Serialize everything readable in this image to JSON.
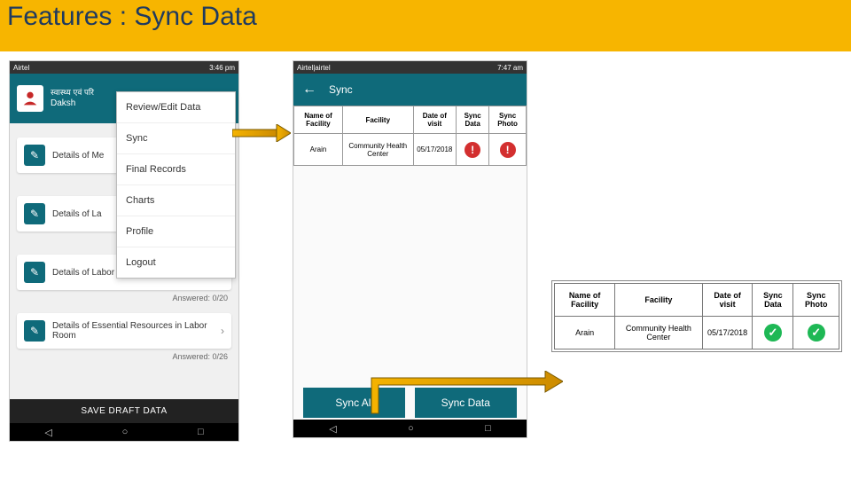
{
  "title": "Features : Sync Data",
  "phone1": {
    "status_left": "Airtel",
    "status_right": "3:46 pm",
    "header_hindi": "स्वास्थ्य एवं परि",
    "header_sub": "Daksh",
    "menu": {
      "items": [
        "Review/Edit Data",
        "Sync",
        "Final Records",
        "Charts",
        "Profile",
        "Logout"
      ]
    },
    "cards": [
      {
        "label": "Details of Me"
      },
      {
        "label": "Details of La"
      },
      {
        "label": "Details of Labor Room Infrastructure",
        "answered": "Answered: 0/20"
      },
      {
        "label": "Details of Essential Resources in Labor Room",
        "answered": "Answered: 0/26"
      }
    ],
    "save_draft": "SAVE DRAFT DATA"
  },
  "phone2": {
    "status_left": "Airtel|airtel",
    "status_right": "7:47 am",
    "sync_title": "Sync",
    "table": {
      "headers": [
        "Name of Facility",
        "Facility",
        "Date of visit",
        "Sync Data",
        "Sync Photo"
      ],
      "row": {
        "name": "Arain",
        "facility": "Community Health Center",
        "date": "05/17/2018"
      }
    },
    "btn_all": "Sync All",
    "btn_data": "Sync Data"
  },
  "result": {
    "headers": [
      "Name of Facility",
      "Facility",
      "Date of visit",
      "Sync Data",
      "Sync Photo"
    ],
    "row": {
      "name": "Arain",
      "facility": "Community Health Center",
      "date": "05/17/2018"
    }
  },
  "softkeys": {
    "back": "◁",
    "home": "○",
    "recent": "□"
  }
}
